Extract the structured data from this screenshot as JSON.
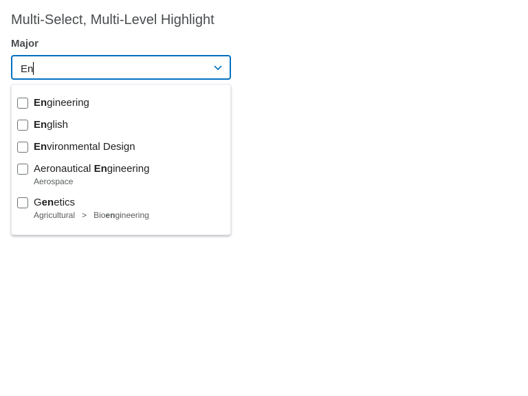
{
  "title": "Multi-Select, Multi-Level Highlight",
  "field": {
    "label": "Major",
    "value": "En",
    "accent": "#006fbf"
  },
  "options": [
    {
      "pre": "",
      "match": "En",
      "post": "gineering"
    },
    {
      "pre": "",
      "match": "En",
      "post": "glish"
    },
    {
      "pre": "",
      "match": "En",
      "post": "vironmental Design"
    },
    {
      "pre": "Aeronautical ",
      "match": "En",
      "post": "gineering",
      "sub": {
        "text": "Aerospace"
      }
    },
    {
      "pre": "G",
      "match": "en",
      "post": "etics",
      "sub": {
        "parent": "Agricultural",
        "separator": ">",
        "pre": "Bio",
        "match": "en",
        "post": "gineering"
      }
    }
  ]
}
